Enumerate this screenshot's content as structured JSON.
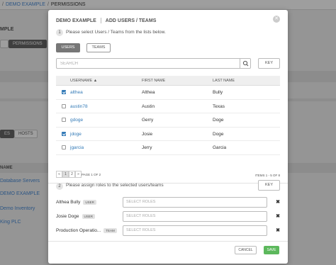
{
  "background": {
    "breadcrumb": [
      "DEMO EXAMPLE",
      "PERMISSIONS"
    ],
    "title": "MPLE",
    "permissions_button": "PERMISSIONS",
    "tabs": [
      "ES",
      "HOSTS"
    ],
    "column_header": "NAME",
    "list_items": [
      "Database Servers",
      "DEMO EXAMPLE",
      "Demo Inventory",
      "King PLC"
    ]
  },
  "modal": {
    "title": "DEMO EXAMPLE",
    "subtitle": "ADD USERS / TEAMS",
    "close_icon": "close-icon",
    "step1_number": "1",
    "step1_text": "Please select Users / Teams from the lists below.",
    "tabs": [
      {
        "label": "USERS",
        "active": true
      },
      {
        "label": "TEAMS",
        "active": false
      }
    ],
    "search": {
      "placeholder": "SEARCH",
      "icon": "search-icon"
    },
    "key_label": "KEY",
    "table": {
      "headers": {
        "username": "USERNAME",
        "first_name": "FIRST NAME",
        "last_name": "LAST NAME"
      },
      "sort_indicator": "▲",
      "rows": [
        {
          "username": "althea",
          "first_name": "Althea",
          "last_name": "Bully",
          "checked": true
        },
        {
          "username": "austin78",
          "first_name": "Austin",
          "last_name": "Texas",
          "checked": false
        },
        {
          "username": "gdoge",
          "first_name": "Gerry",
          "last_name": "Doge",
          "checked": false
        },
        {
          "username": "jdoge",
          "first_name": "Josie",
          "last_name": "Doge",
          "checked": true
        },
        {
          "username": "jgarcia",
          "first_name": "Jerry",
          "last_name": "Garcia",
          "checked": false
        }
      ]
    },
    "pagination": {
      "pages": [
        "1",
        "2"
      ],
      "first": "«",
      "last": "»",
      "page_of": "PAGE 1 OF 2",
      "items": "ITEMS 1 - 5 OF 8"
    },
    "step2_number": "2",
    "step2_text": "Please assign roles to the selected users/teams",
    "step2_key": "KEY",
    "roles": [
      {
        "name": "Althea Bully",
        "type": "USER",
        "placeholder": "SELECT ROLES"
      },
      {
        "name": "Josie Doge",
        "type": "USER",
        "placeholder": "SELECT ROLES"
      },
      {
        "name": "Production Operatio...",
        "type": "TEAM",
        "placeholder": "SELECT ROLES"
      }
    ],
    "remove_glyph": "✖",
    "cancel_label": "CANCEL",
    "save_label": "SAVE",
    "colors": {
      "link": "#337ab7",
      "save": "#5cb85c",
      "checkbox": "#337ab7"
    }
  }
}
